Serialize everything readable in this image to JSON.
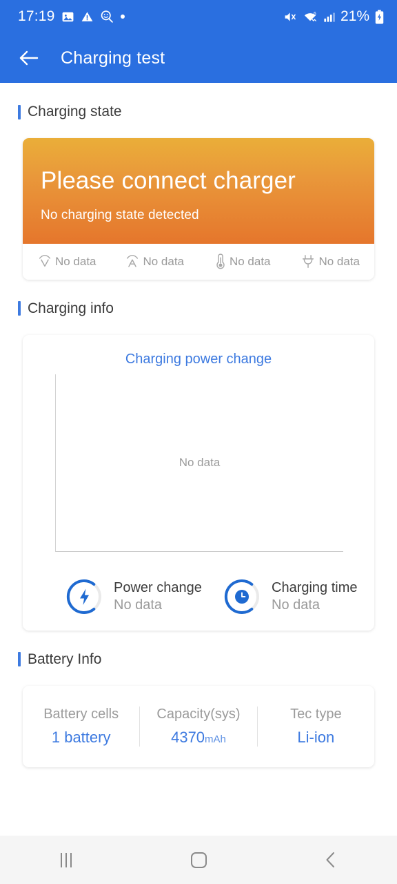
{
  "statusbar": {
    "time": "17:19",
    "battery_percent": "21%",
    "icons_left": [
      "photo-icon",
      "warning-triangle-icon",
      "face-search-icon",
      "dot-icon"
    ],
    "icons_right": [
      "mute-vibrate-icon",
      "wifi6-icon",
      "signal-bars-icon",
      "battery-charging-icon"
    ]
  },
  "appbar": {
    "back_icon": "arrow-left-icon",
    "title": "Charging test"
  },
  "sections": {
    "charging_state": "Charging state",
    "charging_info": "Charging info",
    "battery_info": "Battery Info"
  },
  "charging_state": {
    "headline": "Please connect charger",
    "subtext": "No charging state detected",
    "metrics": [
      {
        "icon": "voltage-icon",
        "value": "No data"
      },
      {
        "icon": "current-icon",
        "value": "No data"
      },
      {
        "icon": "temperature-icon",
        "value": "No data"
      },
      {
        "icon": "plug-icon",
        "value": "No data"
      }
    ]
  },
  "charging_info": {
    "chart_title": "Charging power change",
    "chart_empty_text": "No data",
    "gauges": [
      {
        "icon": "bolt-icon",
        "label": "Power change",
        "value": "No data"
      },
      {
        "icon": "clock-icon",
        "label": "Charging time",
        "value": "No data"
      }
    ]
  },
  "battery_info": {
    "columns": [
      {
        "key": "Battery cells",
        "value": "1 battery",
        "unit": ""
      },
      {
        "key": "Capacity(sys)",
        "value": "4370",
        "unit": "mAh"
      },
      {
        "key": "Tec type",
        "value": "Li-ion",
        "unit": ""
      }
    ]
  },
  "navbar": {
    "recents_icon": "recents-icon",
    "home_icon": "home-icon",
    "back_icon": "back-chevron-icon"
  },
  "colors": {
    "brand_blue": "#2a6fe0",
    "accent_blue": "#3d7ae0",
    "orange_top": "#eaae39",
    "orange_bottom": "#e5762c",
    "muted_gray": "#9b9b9b"
  },
  "chart_data": {
    "type": "line",
    "title": "Charging power change",
    "series": [],
    "x": [],
    "values": [],
    "xlabel": "",
    "ylabel": "",
    "grid": false,
    "legend": "none",
    "empty_state": "No data"
  }
}
